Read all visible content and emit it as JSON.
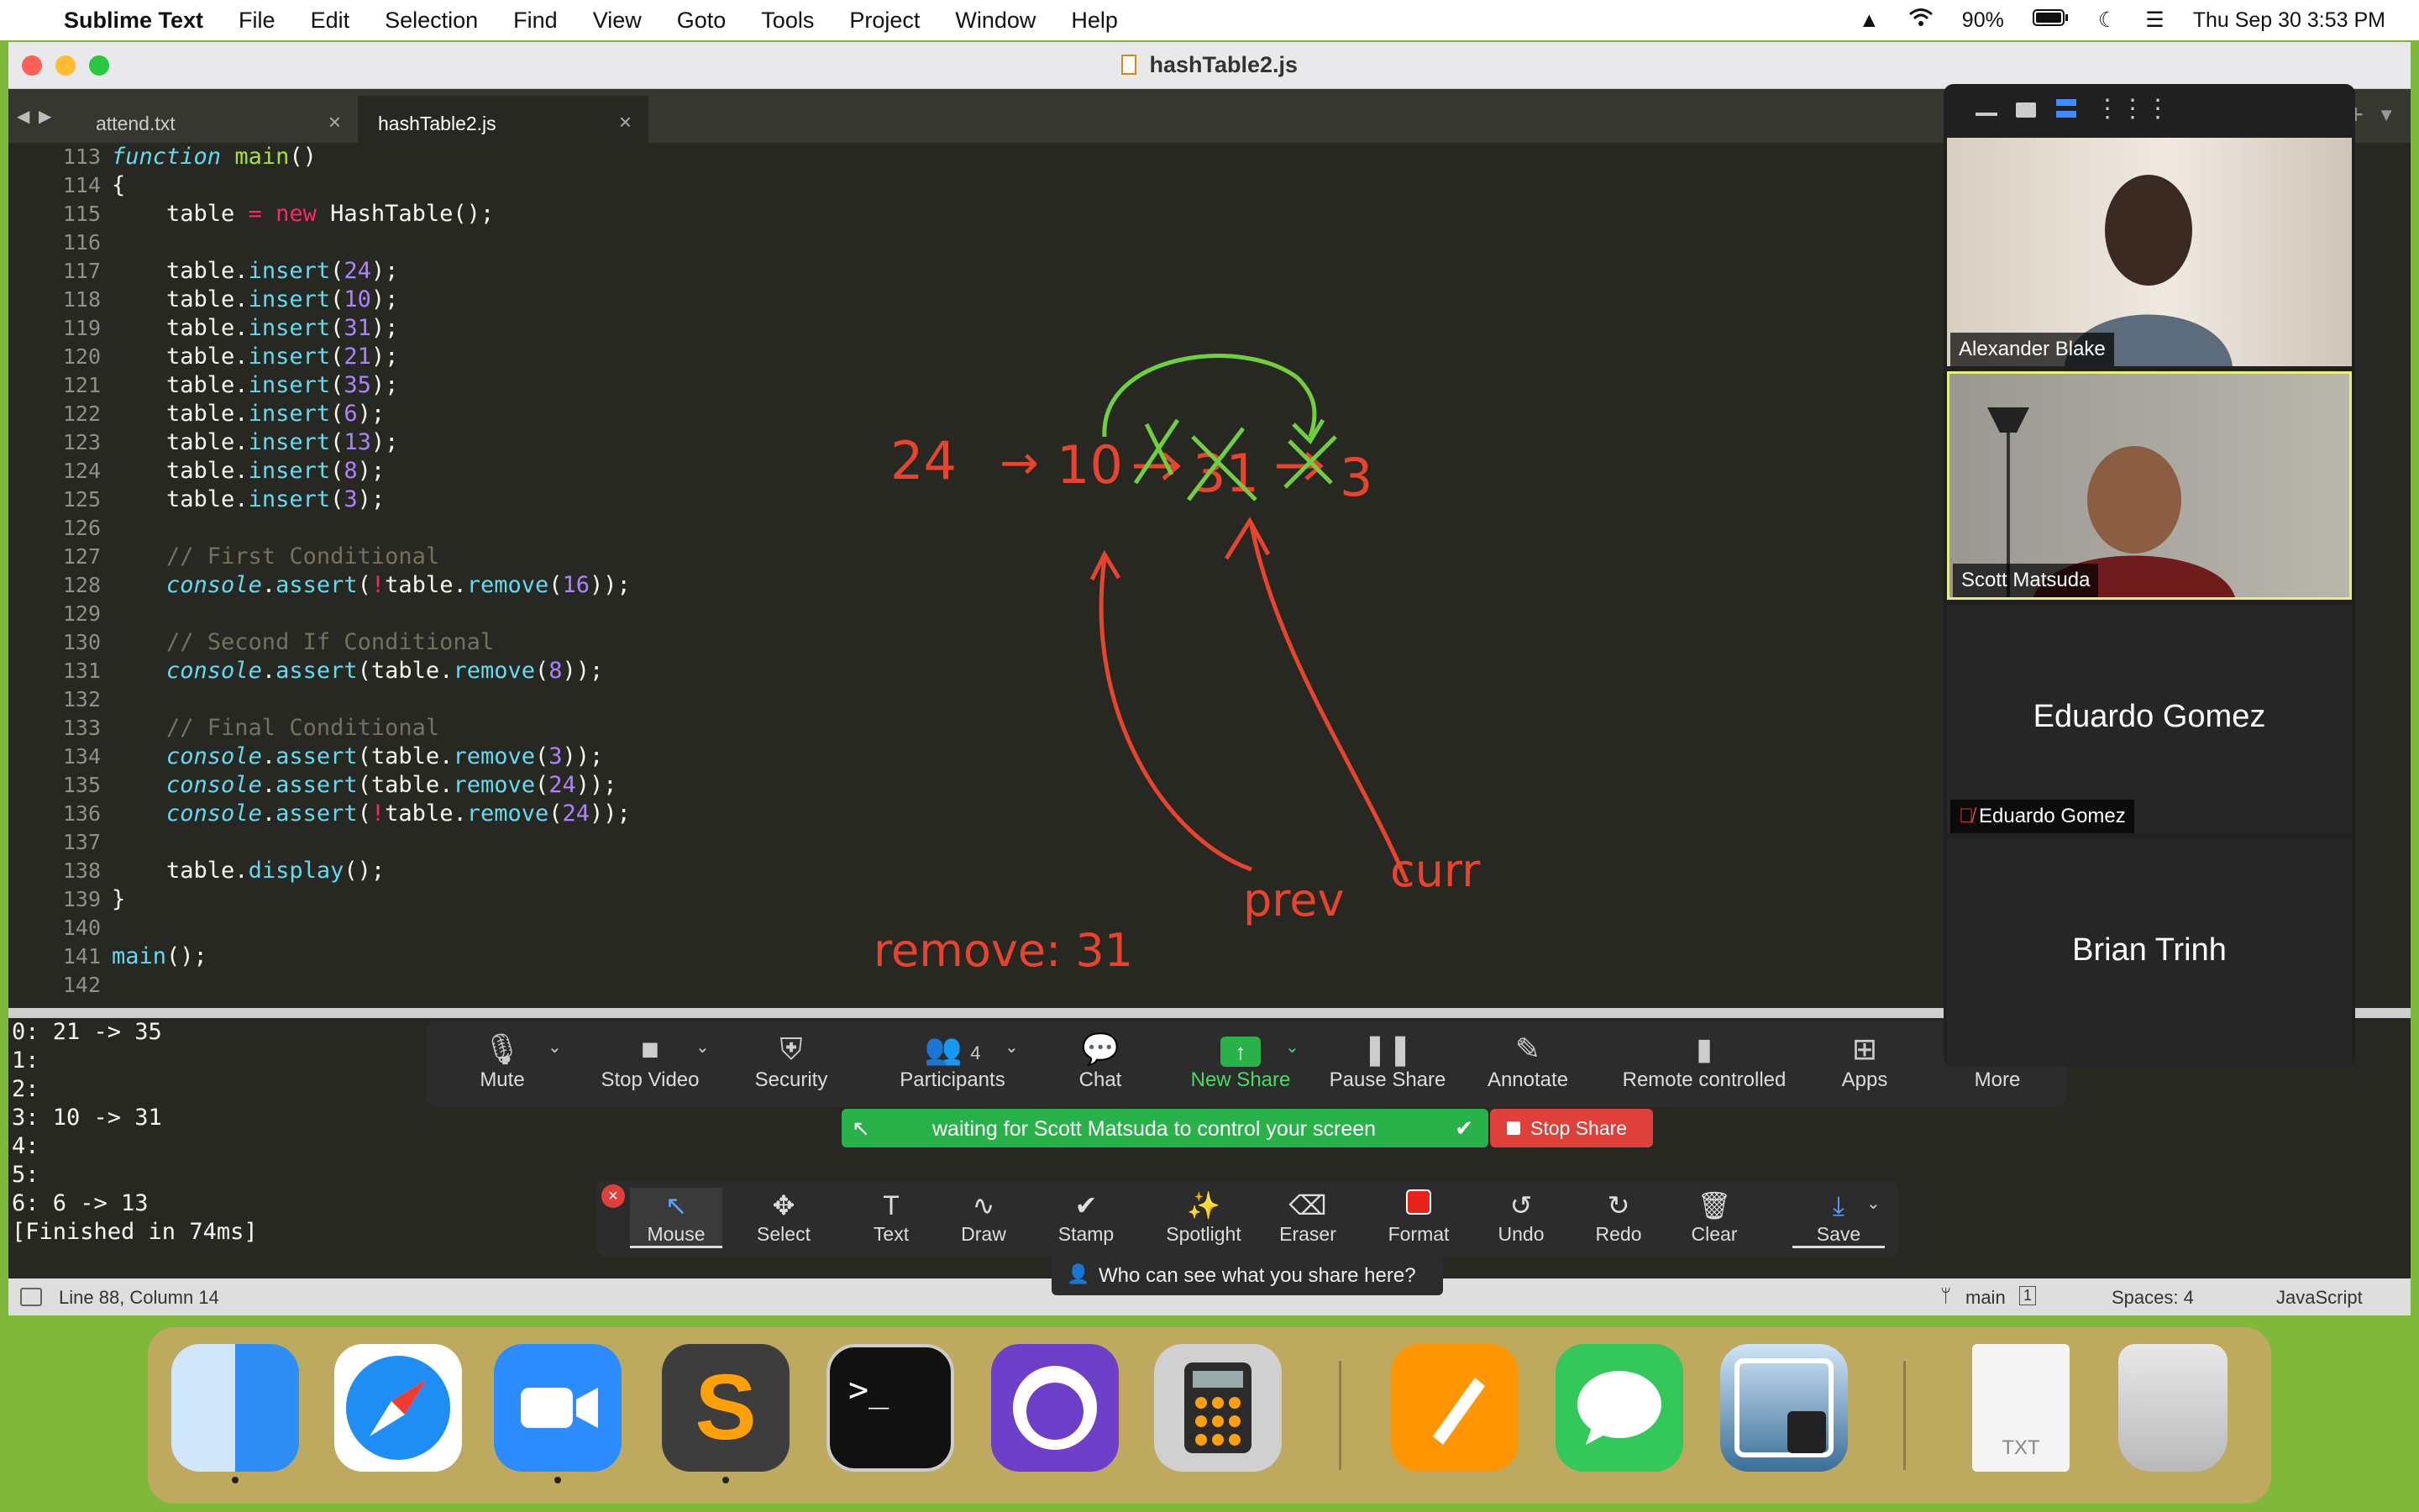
{
  "menubar": {
    "app_name": "Sublime Text",
    "items": [
      "File",
      "Edit",
      "Selection",
      "Find",
      "View",
      "Goto",
      "Tools",
      "Project",
      "Window",
      "Help"
    ],
    "battery": "90%",
    "datetime": "Thu Sep 30  3:53 PM"
  },
  "window": {
    "title": "hashTable2.js"
  },
  "tabs": [
    {
      "label": "attend.txt"
    },
    {
      "label": "hashTable2.js"
    }
  ],
  "editor": {
    "line_numbers": [
      "113",
      "114",
      "115",
      "116",
      "117",
      "118",
      "119",
      "120",
      "121",
      "122",
      "123",
      "124",
      "125",
      "126",
      "127",
      "128",
      "129",
      "130",
      "131",
      "132",
      "133",
      "134",
      "135",
      "136",
      "137",
      "138",
      "139",
      "140",
      "141",
      "142"
    ]
  },
  "annotation": {
    "chain_24": "24",
    "arrow1": "→",
    "chain_10": "10",
    "chain_31": "31",
    "chain_3": "3",
    "label_prev": "prev",
    "label_curr": "curr",
    "label_remove": "remove: 31"
  },
  "console": {
    "lines": [
      "0: 21 -> 35",
      "1:",
      "2:",
      "3: 10 -> 31",
      "4:",
      "5:",
      "6: 6 -> 13",
      "[Finished in 74ms]"
    ]
  },
  "statusbar": {
    "position": "Line 88, Column 14",
    "branch": "main",
    "branch_count": "1",
    "spaces": "Spaces: 4",
    "syntax": "JavaScript"
  },
  "zoom_toolbar": {
    "mute": "Mute",
    "stop_video": "Stop Video",
    "security": "Security",
    "participants": "Participants",
    "participants_count": "4",
    "chat": "Chat",
    "new_share": "New Share",
    "pause_share": "Pause Share",
    "annotate": "Annotate",
    "remote_controlled": "Remote controlled",
    "apps": "Apps",
    "more": "More"
  },
  "share_banner": {
    "waiting_text": "waiting for Scott Matsuda to control your screen",
    "stop_share": "Stop Share"
  },
  "annotate_tools": {
    "mouse": "Mouse",
    "select": "Select",
    "text": "Text",
    "draw": "Draw",
    "stamp": "Stamp",
    "spotlight": "Spotlight",
    "eraser": "Eraser",
    "format": "Format",
    "undo": "Undo",
    "redo": "Redo",
    "clear": "Clear",
    "save": "Save"
  },
  "who_can_see": "Who can see what you share here?",
  "participants": [
    {
      "name": "Alexander Blake"
    },
    {
      "name": "Scott Matsuda"
    },
    {
      "name": "Eduardo Gomez"
    },
    {
      "name": "Brian Trinh"
    }
  ],
  "dock": {
    "txt_label": "TXT"
  },
  "colors": {
    "editor_bg": "#272822",
    "annotation_red": "#e8432c",
    "annotation_green": "#6fcf3f",
    "share_green": "#2ab24a"
  }
}
